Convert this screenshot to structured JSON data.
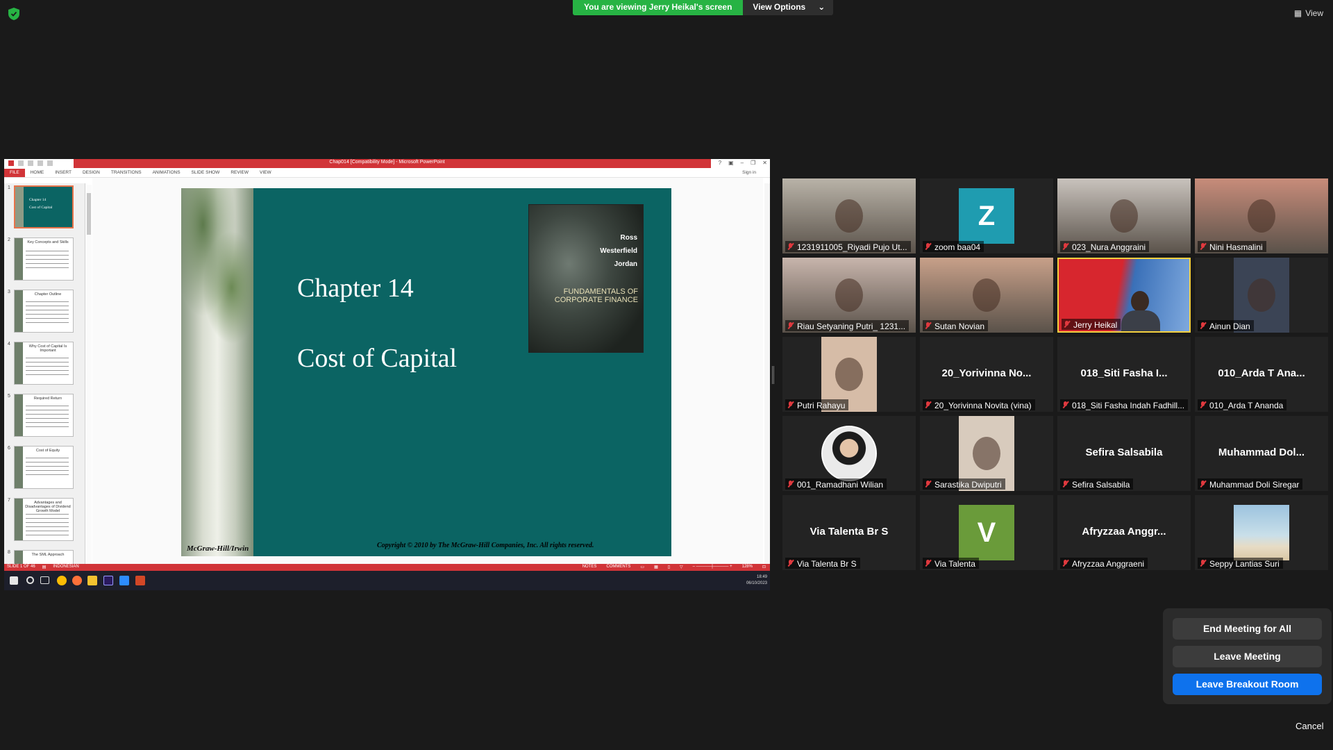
{
  "top": {
    "viewing_text": "You are viewing Jerry Heikal's screen",
    "view_options": "View Options",
    "view_button": "View"
  },
  "powerpoint": {
    "doc_title": "Chap014 [Compatibility Mode] - Microsoft PowerPoint",
    "ribbon_tabs": [
      "FILE",
      "HOME",
      "INSERT",
      "DESIGN",
      "TRANSITIONS",
      "ANIMATIONS",
      "SLIDE SHOW",
      "REVIEW",
      "VIEW"
    ],
    "sign_in": "Sign in",
    "thumbnails": [
      {
        "num": "1",
        "title": "Chapter 14\nCost of Capital"
      },
      {
        "num": "2",
        "title": "Key Concepts and Skills"
      },
      {
        "num": "3",
        "title": "Chapter Outline"
      },
      {
        "num": "4",
        "title": "Why Cost of Capital Is Important"
      },
      {
        "num": "5",
        "title": "Required Return"
      },
      {
        "num": "6",
        "title": "Cost of Equity"
      },
      {
        "num": "7",
        "title": "Advantages and Disadvantages of Dividend Growth Model"
      },
      {
        "num": "8",
        "title": "The SML Approach"
      }
    ],
    "slide": {
      "chapter": "Chapter 14",
      "title": "Cost of Capital",
      "publisher": "McGraw-Hill/Irwin",
      "copyright": "Copyright © 2010 by The McGraw-Hill Companies, Inc. All rights reserved.",
      "book_authors": [
        "Ross",
        "Westerfield",
        "Jordan"
      ],
      "book_title": "FUNDAMENTALS OF\nCORPORATE FINANCE"
    },
    "status": {
      "slide_count": "SLIDE 1 OF 46",
      "language": "INDONESIAN",
      "notes": "NOTES",
      "comments": "COMMENTS",
      "zoom": "128%"
    },
    "clock": {
      "time": "18:49",
      "date": "06/10/2023"
    }
  },
  "participants": [
    {
      "label": "1231911005_Riyadi Pujo Ut...",
      "video": "person",
      "tone": "#b9b3a8"
    },
    {
      "label": "zoom baa04",
      "avatar": "Z",
      "avatar_color": "#1f9cb0"
    },
    {
      "label": "023_Nura Anggraini",
      "video": "person",
      "tone": "#c9c3bd"
    },
    {
      "label": "Nini Hasmalini",
      "video": "person",
      "tone": "#c88c7a"
    },
    {
      "label": "Riau Setyaning Putri_ 1231...",
      "video": "person",
      "tone": "#c8b5ac"
    },
    {
      "label": "Sutan Novian",
      "video": "person",
      "tone": "#c8a089"
    },
    {
      "label": "Jerry Heikal",
      "video": "banner",
      "active": true
    },
    {
      "label": "Ainun Dian",
      "video": "person",
      "tone": "#3b4455"
    },
    {
      "label": "Putri Rahayu",
      "video": "person",
      "tone": "#d6bca7"
    },
    {
      "label": "20_Yorivinna Novita (vina)",
      "name": "20_Yorivinna  No..."
    },
    {
      "label": "018_Siti Fasha Indah Fadhill...",
      "name": "018_Siti Fasha I..."
    },
    {
      "label": "010_Arda T Ananda",
      "name": "010_Arda T Ana..."
    },
    {
      "label": "001_Ramadhani Wilian",
      "video": "round",
      "tone": "#e9e9e9"
    },
    {
      "label": "Sarastika Dwiputri",
      "video": "person",
      "tone": "#d8cbbd"
    },
    {
      "label": "Sefira Salsabila",
      "name": "Sefira Salsabila"
    },
    {
      "label": "Muhammad Doli Siregar",
      "name": "Muhammad  Dol..."
    },
    {
      "label": "Via Talenta Br S",
      "name": "Via Talenta Br S"
    },
    {
      "label": "Via Talenta",
      "avatar": "V",
      "avatar_color": "#6a9b3a"
    },
    {
      "label": "Afryzzaa Anggraeni",
      "name": "Afryzzaa  Anggr..."
    },
    {
      "label": "Seppy Lantias Suri",
      "video": "beach",
      "tone": "#8bb0c6"
    }
  ],
  "leave_panel": {
    "end_all": "End Meeting for All",
    "leave": "Leave Meeting",
    "leave_breakout": "Leave Breakout Room",
    "cancel": "Cancel"
  },
  "colors": {
    "zoom_green": "#27b344",
    "zoom_blue": "#0e72ed",
    "ppt_red": "#d13438",
    "slide_teal": "#0b6463",
    "active_speaker": "#f4d03f"
  }
}
